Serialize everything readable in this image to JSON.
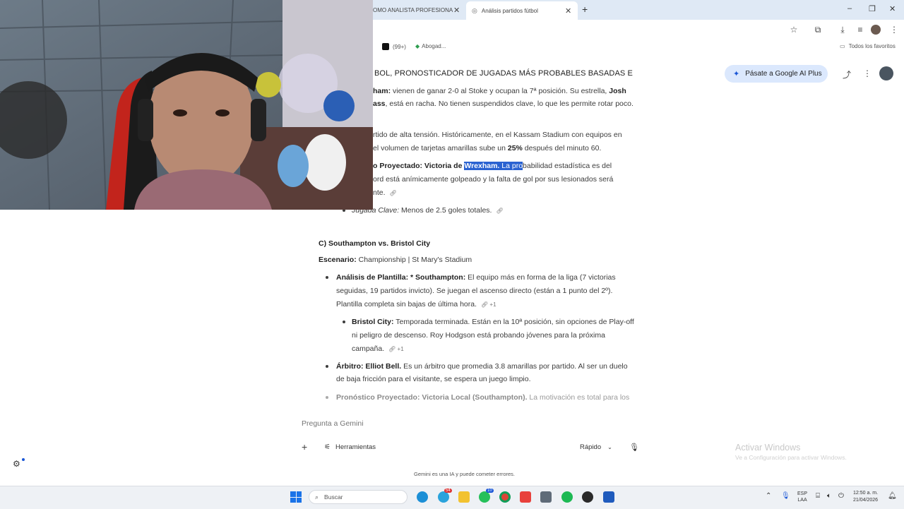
{
  "browser": {
    "tabs": [
      {
        "label": "OMO ANALISTA PROFESIONA",
        "active": false
      },
      {
        "label": "Análisis partidos fútbol",
        "active": true
      }
    ],
    "new_tab_label": "+",
    "window_controls": {
      "minimize": "–",
      "maximize": "❐",
      "close": "✕"
    },
    "bookmarks": [
      {
        "label": "(99+)"
      },
      {
        "label": "Abogad..."
      }
    ],
    "all_favorites_label": "Todos los favoritos"
  },
  "gemini": {
    "chat_title": "BOL, PRONOSTICADOR DE JUGADAS MÁS PROBABLES BASADAS E",
    "upgrade_label": "Pásate a Google AI Plus",
    "input_placeholder": "Pregunta a Gemini",
    "tools_label": "Herramientas",
    "mode_label": "Rápido",
    "disclaimer": "Gemini es una IA y puede cometer errores."
  },
  "content": {
    "p1_line1_bold": "ham:",
    "p1_line1_text": " vienen de ganar 2-0 al Stoke y ocupan la 7ª posición. Su estrella, ",
    "p1_line1_bold2": "Josh",
    "p1_line2_bold": "ass",
    "p1_line2_text": ", está en racha. No tienen suspendidos clave, lo que les permite rotar poco.",
    "p2_line1": "rtido de alta tensión. Históricamente, en el Kassam Stadium con equipos en",
    "p2_line2_a": "el volumen de tarjetas amarillas sube un ",
    "p2_line2_bold": "25%",
    "p2_line2_b": " después del minuto 60.",
    "p3_line1_bold": "o Proyectado: Victoria de ",
    "p3_line1_hl_bold": "Wrexham.",
    "p3_line1_hl": " La pro",
    "p3_line1_rest": "babilidad estadística es del",
    "p3_line2": "ord está anímicamente golpeado y la falta de gol por sus lesionados será",
    "p3_line3": "nte.",
    "key_play_label": "Jugada Clave:",
    "key_play_text": " Menos de 2.5 goles totales.",
    "section_c_title": "C) Southampton vs. Bristol City",
    "escenario_label": "Escenario:",
    "escenario_text": " Championship | St Mary's Stadium",
    "plantilla_label": "Análisis de Plantilla: * Southampton:",
    "plantilla_l1": " El equipo más en forma de la liga (7 victorias",
    "plantilla_l2": "seguidas, 19 partidos invicto). Se juegan el ascenso directo (están a 1 punto del 2º).",
    "plantilla_l3": "Plantilla completa sin bajas de última hora.",
    "plantilla_cite": "+1",
    "bristol_label": "Bristol City:",
    "bristol_l1": " Temporada terminada. Están en la 10ª posición, sin opciones de Play-off",
    "bristol_l2": "ni peligro de descenso. Roy Hodgson está probando jóvenes para la próxima",
    "bristol_l3": "campaña.",
    "bristol_cite": "+1",
    "arbitro_label": "Árbitro: Elliot Bell.",
    "arbitro_l1": " Es un árbitro que promedia 3.8 amarillas por partido. Al ser un duelo",
    "arbitro_l2": "de baja fricción para el visitante, se espera un juego limpio.",
    "pron_label": "Pronóstico Proyectado: Victoria Local (Southampton).",
    "pron_text": " La motivación es total para los"
  },
  "windows": {
    "activate_title": "Activar Windows",
    "activate_sub": "Ve a Configuración para activar Windows.",
    "search_label": "Buscar",
    "lang_top": "ESP",
    "lang_bottom": "LAA",
    "time": "12:50 a. m.",
    "date": "21/04/2026",
    "badge_telegram": "54",
    "badge_whatsapp": "10"
  },
  "colors": {
    "tabstrip": "#dfe9f5",
    "upgrade_bg": "#dbe8fd",
    "highlight": "#2a62d1",
    "taskbar": "#eef1f5"
  }
}
